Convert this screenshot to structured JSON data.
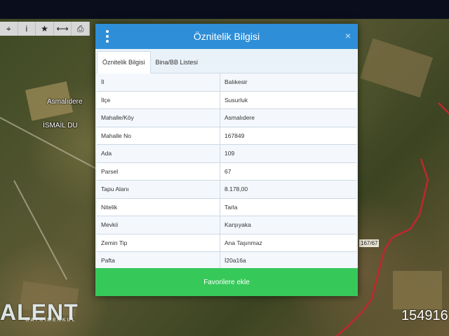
{
  "toolbar": {
    "icons": [
      "crosshair-icon",
      "info-icon",
      "star-icon",
      "measure-icon",
      "print-icon"
    ],
    "glyphs": [
      "⌖",
      "i",
      "★",
      "⟷",
      "⎙"
    ]
  },
  "map": {
    "labels": {
      "village": "Asmalıdere",
      "road": "İSMAİL DU",
      "parcel": "167/67"
    },
    "boundary_color": "#c0272d"
  },
  "modal": {
    "title": "Öznitelik Bilgisi",
    "close_glyph": "×",
    "tabs": [
      {
        "label": "Öznitelik Bilgisi",
        "active": true
      },
      {
        "label": "Bina/BB Listesi",
        "active": false
      }
    ],
    "rows": [
      {
        "key": "İl",
        "value": "Balıkesir"
      },
      {
        "key": "İlçe",
        "value": "Susurluk"
      },
      {
        "key": "Mahalle/Köy",
        "value": "Asmalıdere"
      },
      {
        "key": "Mahalle No",
        "value": "167849"
      },
      {
        "key": "Ada",
        "value": "109"
      },
      {
        "key": "Parsel",
        "value": "67"
      },
      {
        "key": "Tapu Alanı",
        "value": "8.178,00"
      },
      {
        "key": "Nitelik",
        "value": "Tarla"
      },
      {
        "key": "Mevkii",
        "value": "Karşıyaka"
      },
      {
        "key": "Zemin Tip",
        "value": "Ana Taşınmaz"
      },
      {
        "key": "Pafta",
        "value": "İ20a16a"
      }
    ],
    "button_label": "Favorilere ekle",
    "header_color": "#2e8ed8",
    "button_color": "#37c85a"
  },
  "watermark": {
    "logo_text": "ALENT",
    "logo_subtext": "GAYRİMENKUL"
  },
  "listing_number": "154916"
}
